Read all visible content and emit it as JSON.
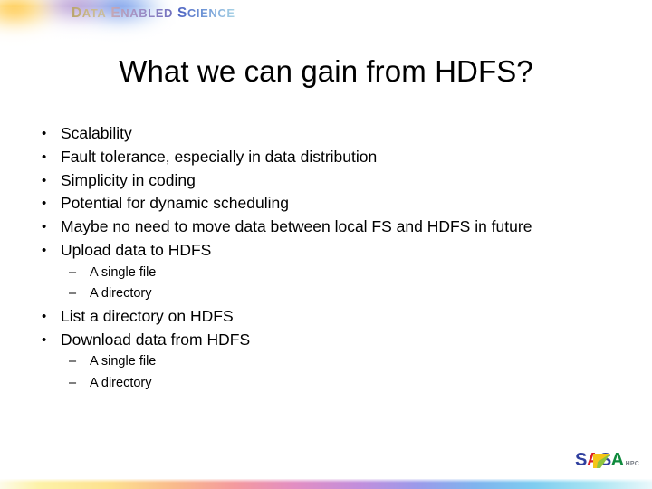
{
  "header": {
    "wordmark": {
      "word1_cap": "D",
      "word1_rest": "ATA",
      "word2_cap": "E",
      "word2_rest": "NABLED",
      "word3_cap": "S",
      "word3_rest": "CIENCE",
      "full_text": "DATA ENABLED SCIENCE"
    },
    "decoration_name": "gradient-swoosh"
  },
  "title": "What we can gain from HDFS?",
  "content": {
    "bullet_marker": "•",
    "sub_bullet_marker": "–",
    "items": [
      {
        "level": 1,
        "text": "Scalability"
      },
      {
        "level": 1,
        "text": "Fault tolerance, especially in data distribution"
      },
      {
        "level": 1,
        "text": "Simplicity in coding"
      },
      {
        "level": 1,
        "text": "Potential for dynamic scheduling"
      },
      {
        "level": 1,
        "text": "Maybe no need to move data between local FS and HDFS in future"
      },
      {
        "level": 1,
        "text": "Upload data to HDFS"
      },
      {
        "level": 2,
        "text": "A single file"
      },
      {
        "level": 2,
        "text": "A directory"
      },
      {
        "level": 1,
        "text": "List a directory on HDFS"
      },
      {
        "level": 1,
        "text": "Download data from HDFS"
      },
      {
        "level": 2,
        "text": "A single file"
      },
      {
        "level": 2,
        "text": "A directory"
      }
    ]
  },
  "logo": {
    "letters": [
      {
        "char": "S",
        "color": "#2f3f9e"
      },
      {
        "char": "A",
        "color": "#d81f26"
      },
      {
        "char": "S",
        "color": "#2f3f9e"
      },
      {
        "char": "A",
        "color": "#0f8a3d"
      }
    ],
    "full_text": "SALSA",
    "subtext": "HPC",
    "swoosh_color_top": "#f5c518",
    "swoosh_color_bottom": "#8fc43f"
  },
  "colors": {
    "title_text": "#000000",
    "body_text": "#000000",
    "background": "#ffffff",
    "bar_left": "#fdf2a8",
    "bar_mid": "#c28edc",
    "bar_right": "#a8e4f2"
  }
}
